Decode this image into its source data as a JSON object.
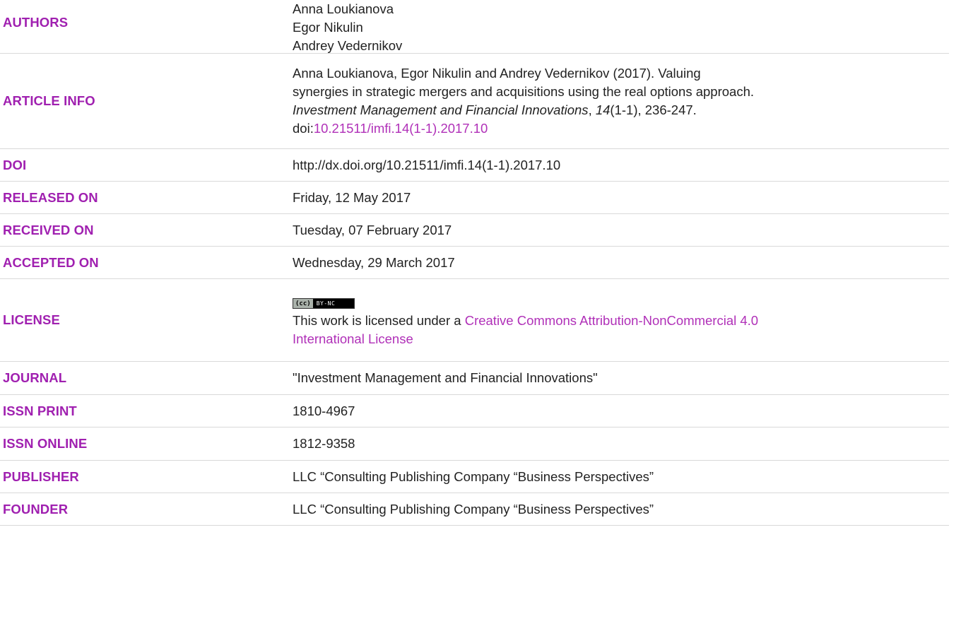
{
  "rows": {
    "authors": {
      "label": "AUTHORS",
      "names": [
        "Anna Loukianova",
        "Egor Nikulin",
        "Andrey Vedernikov"
      ]
    },
    "article_info": {
      "label": "ARTICLE INFO",
      "line1": "Anna Loukianova, Egor Nikulin and Andrey Vedernikov (2017). Valuing",
      "line2": "synergies in strategic mergers and acquisitions using the real options approach.",
      "journal_italic": "Investment Management and Financial Innovations",
      "sep1": ", ",
      "volume_italic": "14",
      "issue_pages": "(1-1), 236-247.",
      "doi_prefix": "doi:",
      "doi_link": "10.21511/imfi.14(1-1).2017.10"
    },
    "doi": {
      "label": "DOI",
      "value": "http://dx.doi.org/10.21511/imfi.14(1-1).2017.10"
    },
    "released_on": {
      "label": "RELEASED ON",
      "value": "Friday, 12 May 2017"
    },
    "received_on": {
      "label": "RECEIVED ON",
      "value": "Tuesday, 07 February 2017"
    },
    "accepted_on": {
      "label": "ACCEPTED ON",
      "value": "Wednesday, 29 March 2017"
    },
    "license": {
      "label": "LICENSE",
      "badge_left": "(cc)",
      "badge_right": "BY-NC",
      "text_prefix": "This work is licensed under a ",
      "link_line1": "Creative Commons Attribution-NonCommercial 4.0",
      "link_line2": "International License"
    },
    "journal": {
      "label": "JOURNAL",
      "value": "\"Investment Management and Financial Innovations\""
    },
    "issn_print": {
      "label": "ISSN PRINT",
      "value": "1810-4967"
    },
    "issn_online": {
      "label": "ISSN ONLINE",
      "value": "1812-9358"
    },
    "publisher": {
      "label": "PUBLISHER",
      "value": "LLC “Consulting Publishing Company “Business Perspectives”"
    },
    "founder": {
      "label": "FOUNDER",
      "value": "LLC “Consulting Publishing Company “Business Perspectives”"
    }
  },
  "colors": {
    "label": "#a020b0",
    "link": "#b030b8",
    "text": "#222222",
    "divider": "#d9d9d9"
  }
}
